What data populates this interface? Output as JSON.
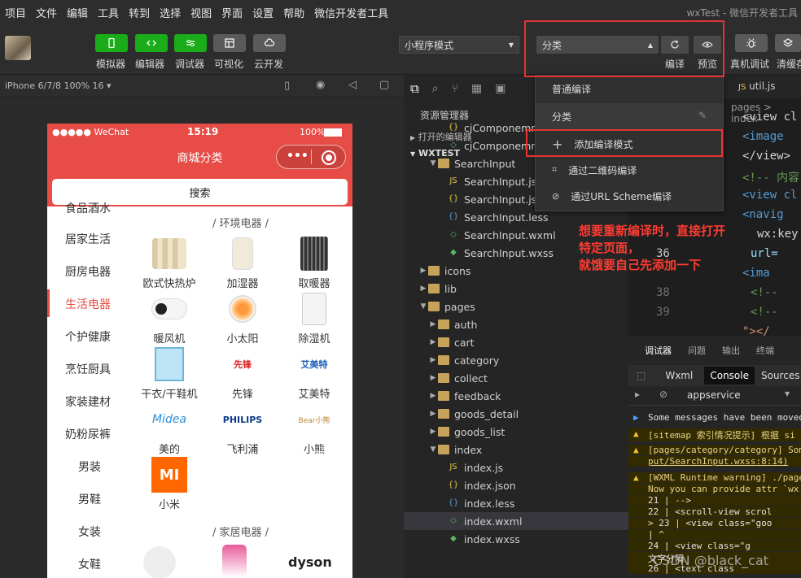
{
  "menu": {
    "items": [
      "项目",
      "文件",
      "编辑",
      "工具",
      "转到",
      "选择",
      "视图",
      "界面",
      "设置",
      "帮助",
      "微信开发者工具"
    ],
    "window_title": "wxTest - 微信开发者工具"
  },
  "toolbar": {
    "simulator": "模拟器",
    "editor": "编辑器",
    "debugger": "调试器",
    "visual": "可视化",
    "cloud": "云开发",
    "mode_select": "小程序模式",
    "compile_select": "分类",
    "compile": "编译",
    "preview": "预览",
    "real_debug": "真机调试",
    "clear_cache": "清缓存"
  },
  "device_bar": {
    "device": "iPhone 6/7/8 100% 16 ▾"
  },
  "phone": {
    "carrier": "●●●●● WeChat",
    "time": "15:19",
    "battery": "100%",
    "nav_title": "商城分类",
    "search": "搜索",
    "categories": [
      "食品酒水",
      "居家生活",
      "厨房电器",
      "生活电器",
      "个护健康",
      "烹饪厨具",
      "家装建材",
      "奶粉尿裤",
      "男装",
      "男鞋",
      "女装",
      "女鞋"
    ],
    "active_category": "生活电器",
    "section1": "/ 环境电器 /",
    "section2": "/ 家居电器 /",
    "products": [
      "欧式快热炉",
      "加湿器",
      "取暖器",
      "暖风机",
      "小太阳",
      "除湿机",
      "干衣/干鞋机",
      "先锋",
      "艾美特",
      "美的",
      "飞利浦",
      "小熊",
      "小米"
    ],
    "brand_logos": {
      "xianfeng": "先锋",
      "airmate": "艾美特",
      "midea": "Midea",
      "philips": "PHILIPS",
      "bear": "Bear小熊",
      "mi": "MI",
      "dyson": "dyson"
    }
  },
  "explorer": {
    "title": "资源管理器",
    "open_editors": "打开的编辑器",
    "project": "WXTEST",
    "rows": [
      {
        "label": "cjComponemnt.",
        "depth": 3,
        "type": "file-json"
      },
      {
        "label": "cjComponemnt.",
        "depth": 3,
        "type": "file-wxml"
      },
      {
        "label": "SearchInput",
        "depth": 2,
        "type": "folder-open"
      },
      {
        "label": "SearchInput.js",
        "depth": 3,
        "type": "file-js"
      },
      {
        "label": "SearchInput.json",
        "depth": 3,
        "type": "file-json"
      },
      {
        "label": "SearchInput.less",
        "depth": 3,
        "type": "file-less"
      },
      {
        "label": "SearchInput.wxml",
        "depth": 3,
        "type": "file-wxml"
      },
      {
        "label": "SearchInput.wxss",
        "depth": 3,
        "type": "file-wxss"
      },
      {
        "label": "icons",
        "depth": 1,
        "type": "folder"
      },
      {
        "label": "lib",
        "depth": 1,
        "type": "folder"
      },
      {
        "label": "pages",
        "depth": 1,
        "type": "folder-open"
      },
      {
        "label": "auth",
        "depth": 2,
        "type": "folder"
      },
      {
        "label": "cart",
        "depth": 2,
        "type": "folder"
      },
      {
        "label": "category",
        "depth": 2,
        "type": "folder"
      },
      {
        "label": "collect",
        "depth": 2,
        "type": "folder"
      },
      {
        "label": "feedback",
        "depth": 2,
        "type": "folder"
      },
      {
        "label": "goods_detail",
        "depth": 2,
        "type": "folder"
      },
      {
        "label": "goods_list",
        "depth": 2,
        "type": "folder"
      },
      {
        "label": "index",
        "depth": 2,
        "type": "folder-open"
      },
      {
        "label": "index.js",
        "depth": 3,
        "type": "file-js"
      },
      {
        "label": "index.json",
        "depth": 3,
        "type": "file-json"
      },
      {
        "label": "index.less",
        "depth": 3,
        "type": "file-less"
      },
      {
        "label": "index.wxml",
        "depth": 3,
        "type": "file-wxml"
      },
      {
        "label": "index.wxss",
        "depth": 3,
        "type": "file-wxss"
      }
    ],
    "selected_row": "index.wxml"
  },
  "editor": {
    "tab": "util.js",
    "breadcrumb": "pages > index",
    "lines": [
      {
        "num": "",
        "text": "<view cl"
      },
      {
        "num": "",
        "text": "  <image"
      },
      {
        "num": "",
        "text": "</view>"
      },
      {
        "num": "",
        "text": "<!-- 内容"
      },
      {
        "num": "",
        "text": "<view cl"
      },
      {
        "num": "",
        "text": "  <navig"
      },
      {
        "num": "",
        "text": "wx:key"
      },
      {
        "num": "36",
        "text": "    url="
      },
      {
        "num": "",
        "text": "    <ima"
      },
      {
        "num": "38",
        "text": "    <!--"
      },
      {
        "num": "39",
        "text": "    <!--"
      },
      {
        "num": "",
        "text": "    \"></"
      }
    ]
  },
  "debugger": {
    "tabs": [
      "调试器",
      "问题",
      "输出",
      "终端"
    ],
    "subtabs": [
      "Wxml",
      "Console",
      "Sources"
    ],
    "context": "appservice",
    "messages": [
      "Some messages have been moved",
      "[sitemap 索引情况提示] 根据 si",
      "[pages/category/category] Som",
      "put/SearchInput.wxss:8:14)",
      "[WXML Runtime warning] ./page",
      " Now you can provide attr `wx",
      "  21 |      -->",
      "  22 |    <scroll-view scrol",
      "> 23 |      <view class=\"goo",
      "     |        ^",
      "  24 |        <view class=\"g",
      "                   文字分隔",
      "  26 |          <text class"
    ]
  },
  "dropdown": {
    "items": [
      "普通编译",
      "分类",
      "添加编译模式",
      "通过二维码编译",
      "通过URL Scheme编译"
    ]
  },
  "annotation": {
    "lines": [
      "想要重新编译时，直接打开",
      "特定页面，",
      "就饿要自己先添加一下"
    ]
  },
  "watermark": "CSDN @black_cat"
}
